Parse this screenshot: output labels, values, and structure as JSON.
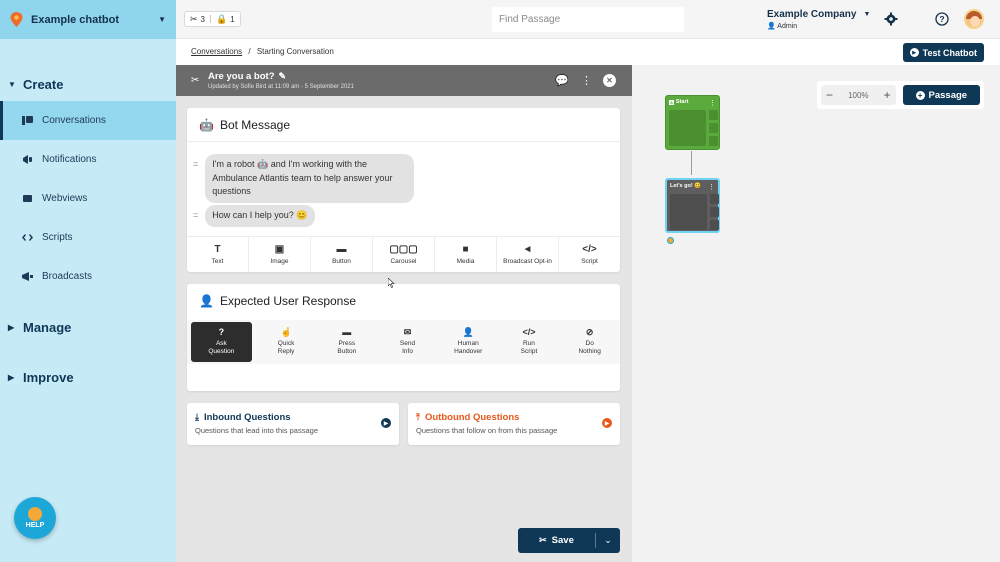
{
  "brand": {
    "name": "Example chatbot"
  },
  "sidebar": {
    "create_label": "Create",
    "items": [
      {
        "label": "Conversations",
        "icon": "chat-bubbles-icon",
        "active": true
      },
      {
        "label": "Notifications",
        "icon": "megaphone-icon",
        "active": false
      },
      {
        "label": "Webviews",
        "icon": "window-icon",
        "active": false
      },
      {
        "label": "Scripts",
        "icon": "code-icon",
        "active": false
      },
      {
        "label": "Broadcasts",
        "icon": "broadcast-icon",
        "active": false
      }
    ],
    "manage_label": "Manage",
    "improve_label": "Improve",
    "help_label": "HELP"
  },
  "topbar": {
    "passages_count": "3",
    "locks_count": "1",
    "search_placeholder": "Find Passage",
    "company": "Example Company",
    "role": "Admin"
  },
  "breadcrumb": {
    "parent": "Conversations",
    "separator": "/",
    "current": "Starting Conversation"
  },
  "test_button": "Test Chatbot",
  "passage": {
    "title": "Are you a bot?",
    "updated": "Updated by Sofie Bird at 11:09 am - 5 September 2021"
  },
  "bot_message": {
    "heading": "Bot Message",
    "messages": [
      "I'm a robot 🤖 and I'm working with the Ambulance Atlantis team to help answer your questions",
      "How can I help you? 😊"
    ],
    "tools": [
      {
        "label": "Text",
        "icon": "T"
      },
      {
        "label": "Image",
        "icon": "▣"
      },
      {
        "label": "Button",
        "icon": "▬"
      },
      {
        "label": "Carousel",
        "icon": "▢▢▢"
      },
      {
        "label": "Media",
        "icon": "■"
      },
      {
        "label": "Broadcast Opt-in",
        "icon": "◄"
      },
      {
        "label": "Script",
        "icon": "</>"
      }
    ]
  },
  "user_response": {
    "heading": "Expected User Response",
    "options": [
      {
        "line1": "Ask",
        "line2": "Question",
        "icon": "?",
        "selected": true
      },
      {
        "line1": "Quick",
        "line2": "Reply",
        "icon": "☝",
        "selected": false
      },
      {
        "line1": "Press",
        "line2": "Button",
        "icon": "▬",
        "selected": false
      },
      {
        "line1": "Send",
        "line2": "Info",
        "icon": "✉",
        "selected": false
      },
      {
        "line1": "Human",
        "line2": "Handover",
        "icon": "👤",
        "selected": false
      },
      {
        "line1": "Run",
        "line2": "Script",
        "icon": "</>",
        "selected": false
      },
      {
        "line1": "Do",
        "line2": "Nothing",
        "icon": "⊘",
        "selected": false
      }
    ]
  },
  "inbound": {
    "title": "Inbound Questions",
    "subtitle": "Questions that lead into this passage",
    "color": "#0f3857"
  },
  "outbound": {
    "title": "Outbound Questions",
    "subtitle": "Questions that follow on from this passage",
    "color": "#e8591a"
  },
  "save": {
    "label": "Save"
  },
  "canvas": {
    "zoom": "100%",
    "passage_button": "Passage",
    "nodes": [
      {
        "title": "Start",
        "color": "#5aaa3c"
      },
      {
        "title": "Let's go! 😊",
        "color": "#5e5e5e",
        "border": "#6fd3f3"
      }
    ]
  },
  "colors": {
    "accent": "#0f3857",
    "sidebar": "#c6eaf6",
    "sidebar_active": "#93d8ef"
  }
}
